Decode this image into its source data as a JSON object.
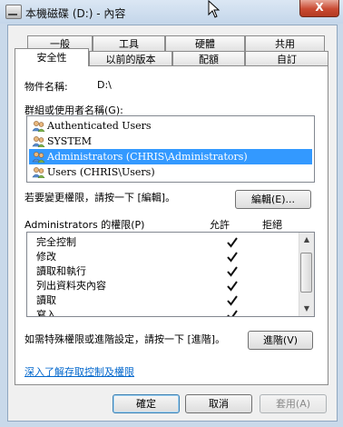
{
  "window": {
    "title": "本機磁碟 (D:) - 內容",
    "close_label": "X"
  },
  "tabs": {
    "row1": [
      "一般",
      "工具",
      "硬體",
      "共用"
    ],
    "row2": [
      "安全性",
      "以前的版本",
      "配額",
      "自訂"
    ],
    "active": "安全性"
  },
  "security": {
    "object_name_label": "物件名稱:",
    "object_name_value": "D:\\",
    "groups_label": "群組或使用者名稱(G):",
    "groups": [
      {
        "name": "Authenticated Users",
        "selected": false
      },
      {
        "name": "SYSTEM",
        "selected": false
      },
      {
        "name": "Administrators (CHRIS\\Administrators)",
        "selected": true
      },
      {
        "name": "Users (CHRIS\\Users)",
        "selected": false
      }
    ],
    "edit_hint": "若要變更權限，請按一下 [編輯]。",
    "edit_button": "編輯(E)...",
    "permissions_label": "Administrators 的權限(P)",
    "allow_header": "允許",
    "deny_header": "拒絕",
    "permissions": [
      {
        "name": "完全控制",
        "allow": true,
        "deny": false
      },
      {
        "name": "修改",
        "allow": true,
        "deny": false
      },
      {
        "name": "讀取和執行",
        "allow": true,
        "deny": false
      },
      {
        "name": "列出資料夾內容",
        "allow": true,
        "deny": false
      },
      {
        "name": "讀取",
        "allow": true,
        "deny": false
      },
      {
        "name": "寫入",
        "allow": true,
        "deny": false
      }
    ],
    "advanced_hint": "如需特殊權限或進階設定，請按一下 [進階]。",
    "advanced_button": "進階(V)",
    "learn_link": "深入了解存取控制及權限"
  },
  "footer": {
    "ok": "確定",
    "cancel": "取消",
    "apply": "套用(A)"
  },
  "colors": {
    "selection": "#3399ff",
    "link": "#0066cc",
    "close": "#c94a32"
  }
}
